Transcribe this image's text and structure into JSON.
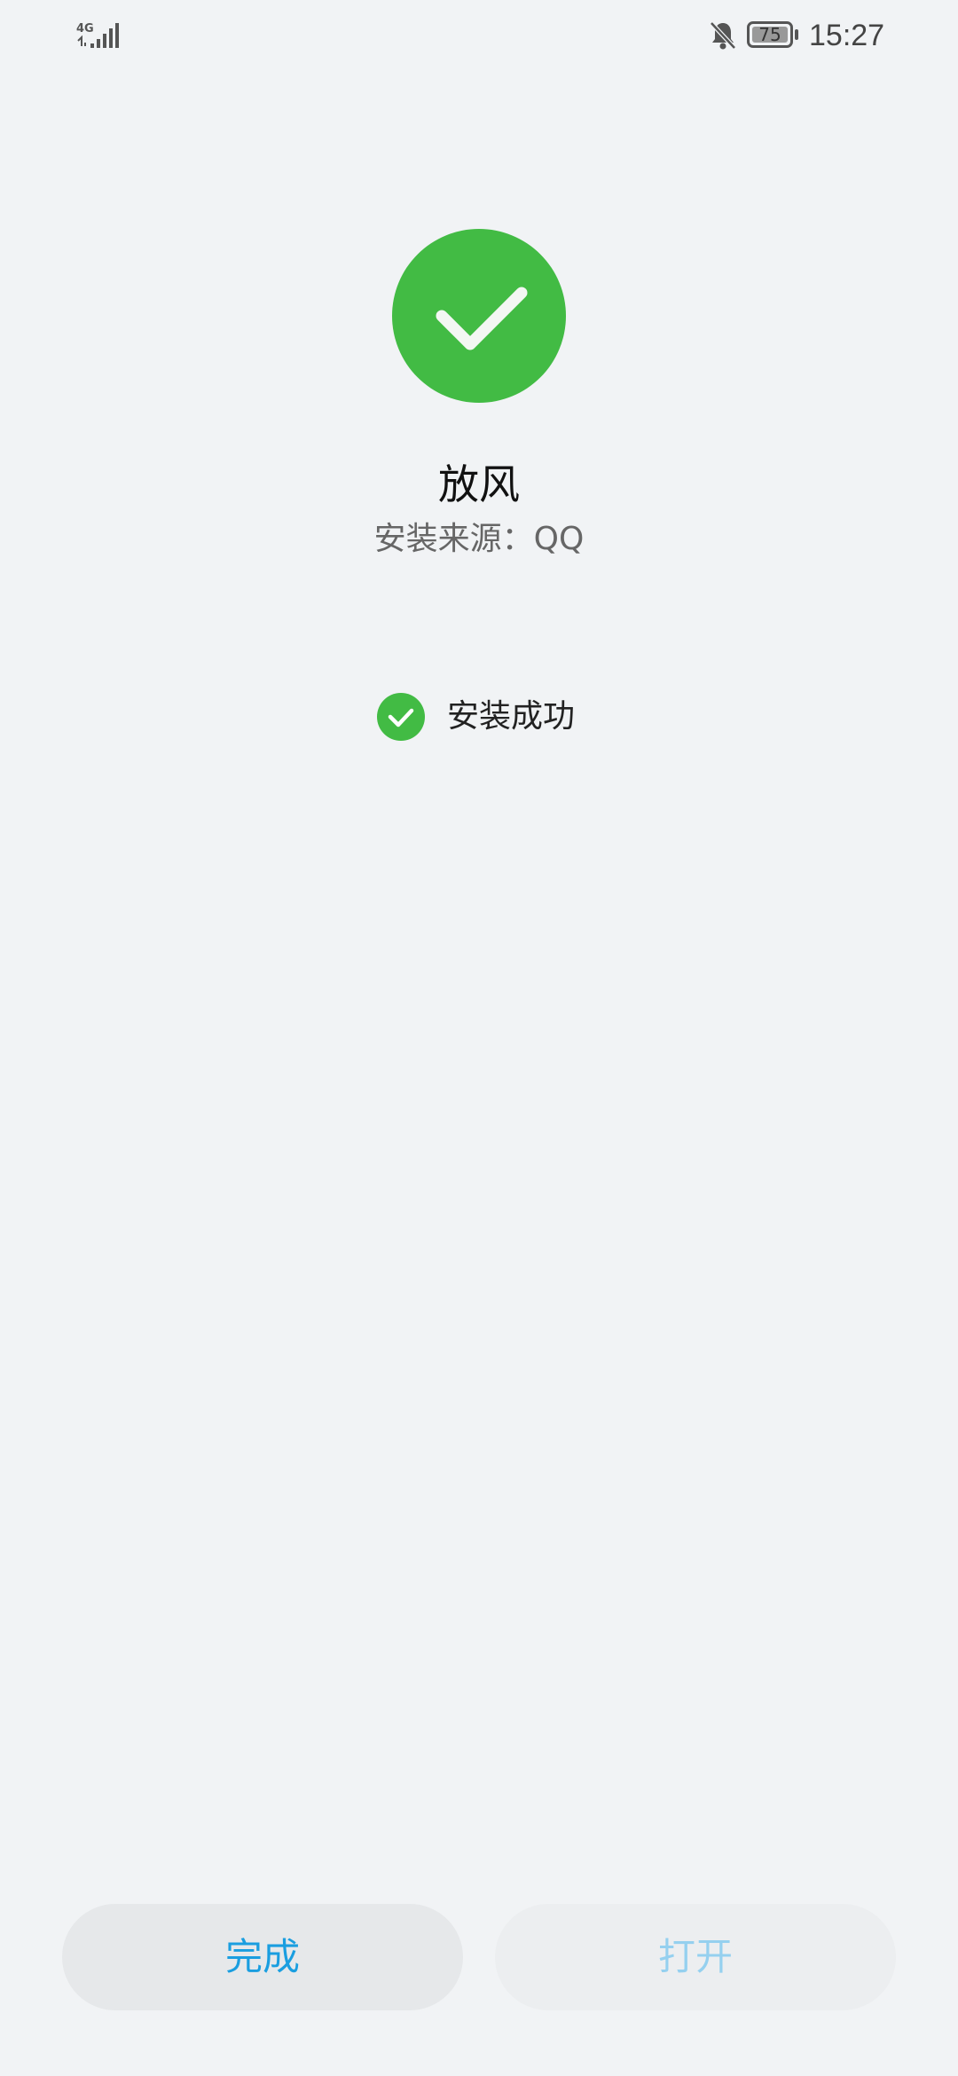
{
  "status_bar": {
    "network": "4G",
    "battery": "75",
    "time": "15:27"
  },
  "app": {
    "name": "放风",
    "install_source": "安装来源：QQ"
  },
  "status": {
    "text": "安装成功"
  },
  "buttons": {
    "done_label": "完成",
    "open_label": "打开"
  },
  "colors": {
    "success_green": "#42bb44",
    "accent_blue": "#1a9ee0",
    "disabled_blue": "#95d0ef",
    "background": "#f1f3f5"
  },
  "icons": {
    "signal": "signal-4g-icon",
    "mute": "bell-off-icon",
    "battery": "battery-icon",
    "success": "check-circle-icon"
  }
}
